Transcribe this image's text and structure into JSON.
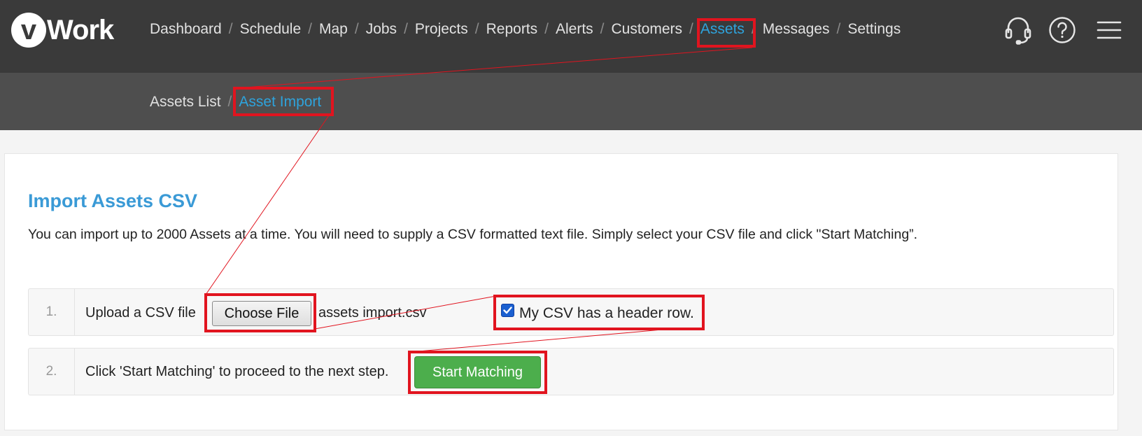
{
  "header": {
    "logo": {
      "badge": "v",
      "text": "Work"
    },
    "nav": [
      {
        "label": "Dashboard",
        "active": false
      },
      {
        "label": "Schedule",
        "active": false
      },
      {
        "label": "Map",
        "active": false
      },
      {
        "label": "Jobs",
        "active": false
      },
      {
        "label": "Projects",
        "active": false
      },
      {
        "label": "Reports",
        "active": false
      },
      {
        "label": "Alerts",
        "active": false
      },
      {
        "label": "Customers",
        "active": false
      },
      {
        "label": "Assets",
        "active": true
      },
      {
        "label": "Messages",
        "active": false
      },
      {
        "label": "Settings",
        "active": false
      }
    ],
    "separator": "/",
    "icons": [
      "headset-icon",
      "help-icon",
      "menu-icon"
    ]
  },
  "subnav": {
    "items": [
      {
        "label": "Assets List",
        "active": false
      },
      {
        "label": "Asset Import",
        "active": true
      }
    ]
  },
  "main": {
    "title": "Import Assets CSV",
    "description": "You can import up to 2000 Assets at a time. You will need to supply a CSV formatted text file. Simply select your CSV file and click \"Start Matching”.",
    "step1": {
      "number": "1.",
      "label": "Upload a CSV file",
      "choose_file_label": "Choose File",
      "file_name": "assets import.csv",
      "header_checkbox_checked": true,
      "header_checkbox_label": "My CSV has a header row."
    },
    "step2": {
      "number": "2.",
      "label": "Click 'Start Matching' to proceed to the next step.",
      "button_label": "Start Matching"
    }
  },
  "colors": {
    "topbar": "#3a3a3a",
    "subbar": "#4e4e4e",
    "accent": "#2ea3dc",
    "highlight": "#e1141f",
    "button_green": "#4cae4c"
  }
}
